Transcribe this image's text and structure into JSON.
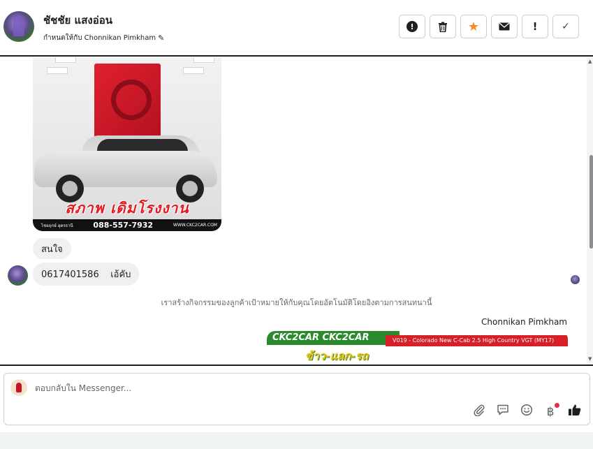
{
  "header": {
    "contact_name": "ชัชชัย แสงอ่อน",
    "assigned_text": "กำหนดให้กับ Chonnikan Pimkham",
    "actions": [
      {
        "name": "spam-button",
        "icon": "alert-circle-icon"
      },
      {
        "name": "delete-button",
        "icon": "trash-icon"
      },
      {
        "name": "star-button",
        "icon": "star-icon"
      },
      {
        "name": "mark-unread-button",
        "icon": "envelope-icon"
      },
      {
        "name": "follow-up-button",
        "icon": "exclamation-icon"
      },
      {
        "name": "mark-done-button",
        "icon": "checkmark-icon"
      }
    ]
  },
  "thread": {
    "car_image": {
      "promo_text": "สภาพ เดิมโรงงาน",
      "footer_phone": "088-557-7932",
      "footer_left": "ไชยฤกษ์ อุดรธานี",
      "footer_right": "WWW.CKC2CAR.COM"
    },
    "messages": [
      {
        "text": "สนใจ"
      },
      {
        "text": "0617401586    เอ้คับ"
      }
    ],
    "system_note": "เราสร้างกิจกรรมของลูกค้าเป้าหมายให้กับคุณโดยอัตโนมัติโดยอิงตามการสนทนานี้",
    "sender_name": "Chonnikan Pimkham",
    "promo_image": {
      "green_text": "CKC2CAR CKC2CAR",
      "red_text": "V019 - Colorado New C-Cab 2.5 High Country VGT (MY17)",
      "yellow_text": "ข้าว-แลก-รถ"
    }
  },
  "composer": {
    "placeholder": "ตอบกลับใน Messenger...",
    "tools": [
      "attach-icon",
      "comment-icon",
      "emoji-icon",
      "baht-icon",
      "thumbs-up-icon"
    ],
    "notification_color": "#f02849"
  },
  "colors": {
    "star": "#f28c28",
    "border": "#1c1e21"
  }
}
